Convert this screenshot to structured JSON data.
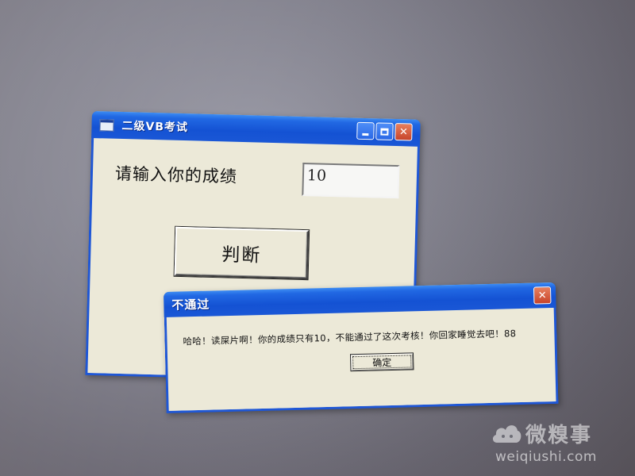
{
  "main_window": {
    "title": "二级VB考试",
    "prompt_label": "请输入你的成绩",
    "score_value": "10",
    "judge_button_label": "判断",
    "controls": {
      "minimize_icon": "minimize-icon",
      "maximize_icon": "maximize-icon",
      "close_icon": "close-icon"
    }
  },
  "message_box": {
    "title": "不通过",
    "message": "哈哈！读屎片啊！你的成绩只有10，不能通过了这次考核！你回家睡觉去吧！88",
    "ok_button_label": "确定"
  },
  "watermark": {
    "name": "微糗事",
    "url": "weiqiushi.com"
  },
  "colors": {
    "titlebar_blue": "#1452d3",
    "window_face": "#ece9d8",
    "close_red": "#c7442a"
  }
}
